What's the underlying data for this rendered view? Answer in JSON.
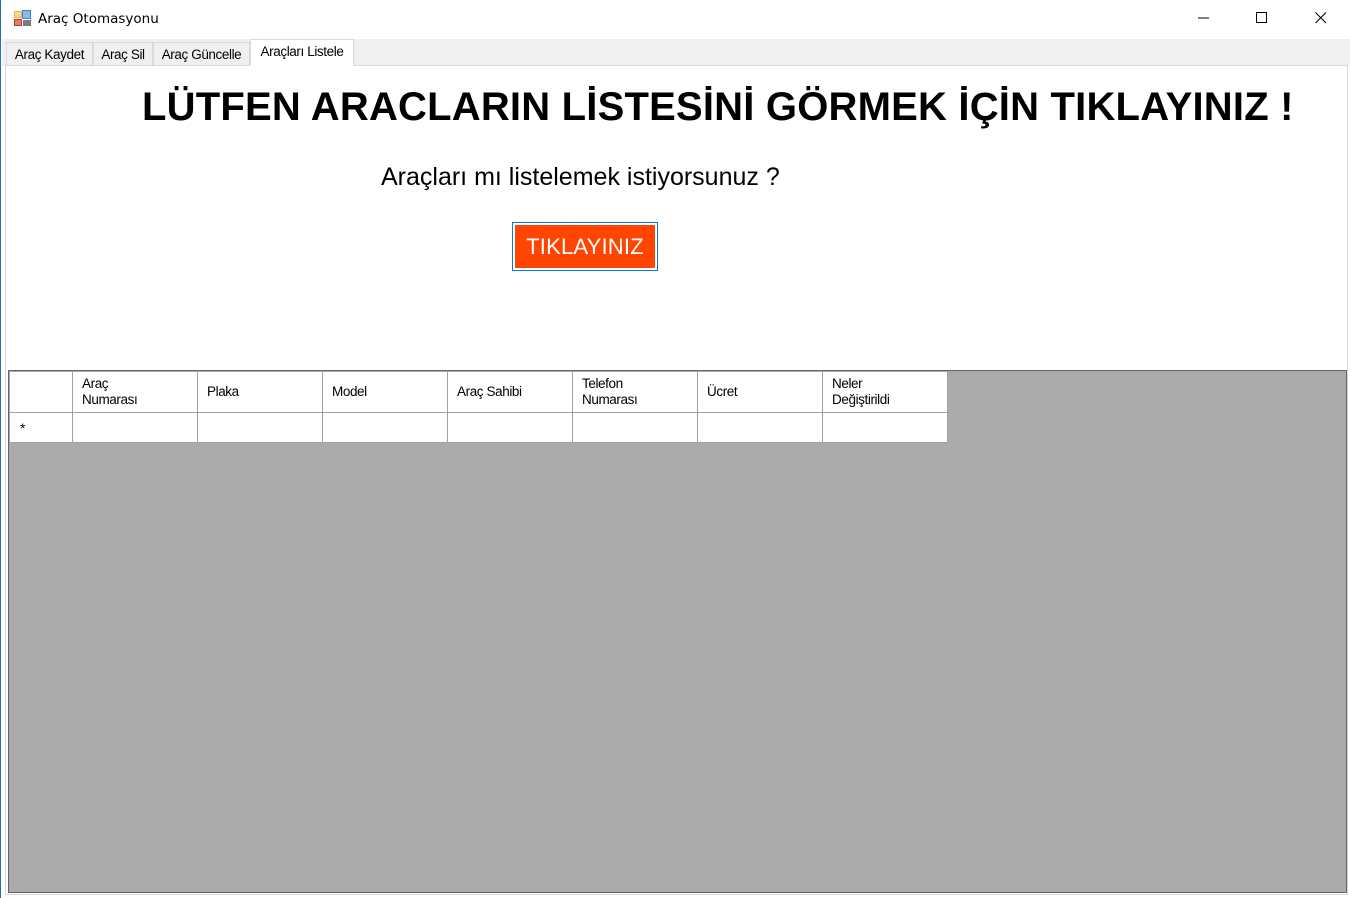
{
  "window": {
    "title": "Araç Otomasyonu",
    "icon": "windows-forms-app-icon",
    "controls": [
      "minimize-icon",
      "maximize-icon",
      "close-icon"
    ]
  },
  "tabs": [
    {
      "label": "Araç Kaydet",
      "active": false
    },
    {
      "label": "Araç Sil",
      "active": false
    },
    {
      "label": "Araç Güncelle",
      "active": false
    },
    {
      "label": "Araçları Listele",
      "active": true
    }
  ],
  "main": {
    "heading": "LÜTFEN ARACLARIN LİSTESİNİ GÖRMEK İÇİN TIKLAYINIZ !",
    "question": "Araçları mı listelemek istiyorsunuz ?",
    "button_label": "TIKLAYINIZ",
    "button_color": "#ff4500"
  },
  "grid": {
    "columns": [
      "Araç\nNumarası",
      "Plaka",
      "Model",
      "Araç Sahibi",
      "Telefon\nNumarası",
      "Ücret",
      "Neler\nDeğiştirildi"
    ],
    "new_row_marker": "*",
    "background_color": "#ababab"
  }
}
